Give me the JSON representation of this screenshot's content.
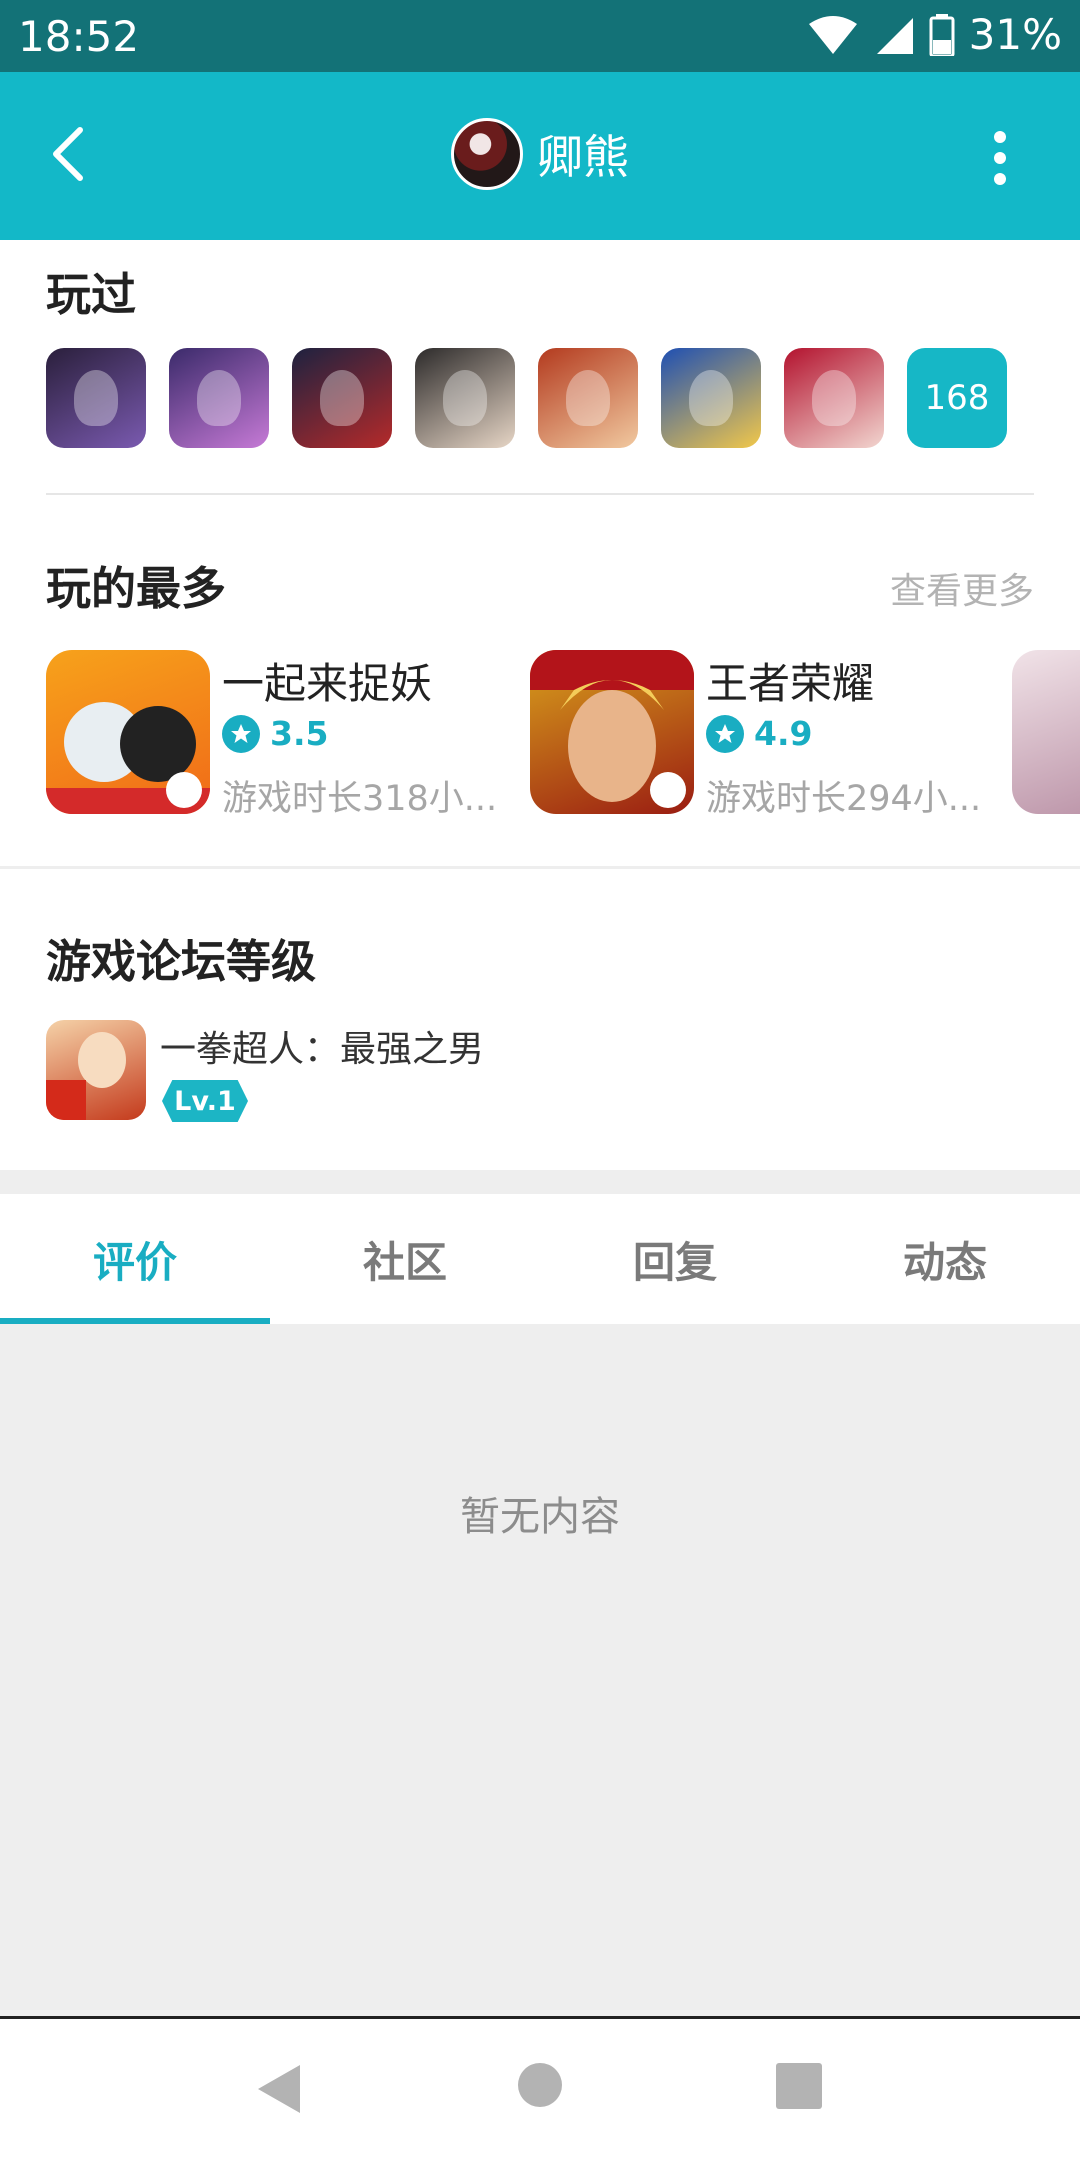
{
  "status_bar": {
    "time": "18:52",
    "battery": "31%"
  },
  "header": {
    "title": "卿熊"
  },
  "played": {
    "title": "玩过",
    "games": [
      {
        "name": "game-1",
        "colors": [
          "#2a1f3b",
          "#7a5ab0"
        ]
      },
      {
        "name": "game-2",
        "colors": [
          "#3a2a6a",
          "#c67ad6"
        ]
      },
      {
        "name": "game-3",
        "colors": [
          "#1d2240",
          "#b52a2a"
        ]
      },
      {
        "name": "game-4",
        "colors": [
          "#2c2a2a",
          "#e7d6c6"
        ]
      },
      {
        "name": "game-5",
        "colors": [
          "#b33a1e",
          "#f1c9a0"
        ]
      },
      {
        "name": "game-6",
        "colors": [
          "#1e4fb3",
          "#f2c84a"
        ]
      },
      {
        "name": "game-7",
        "colors": [
          "#b3122e",
          "#f2d6d0"
        ]
      }
    ],
    "count": "168"
  },
  "most_played": {
    "title": "玩的最多",
    "more": "查看更多",
    "items": [
      {
        "name": "一起来捉妖",
        "rating": "3.5",
        "time": "游戏时长318小..."
      },
      {
        "name": "王者荣耀",
        "rating": "4.9",
        "time": "游戏时长294小..."
      }
    ]
  },
  "forum_level": {
    "title": "游戏论坛等级",
    "game": "一拳超人：最强之男",
    "level": "Lv.1"
  },
  "tabs": [
    "评价",
    "社区",
    "回复",
    "动态"
  ],
  "active_tab": "评价",
  "empty_text": "暂无内容"
}
